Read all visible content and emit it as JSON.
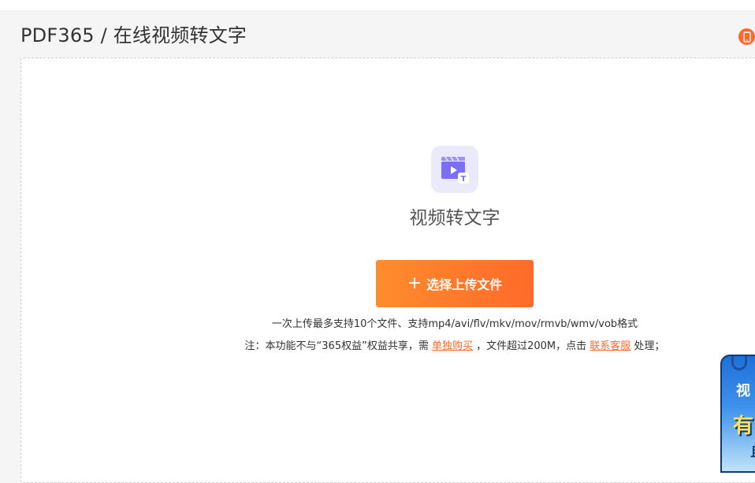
{
  "header": {
    "title": "PDF365 / 在线视频转文字"
  },
  "tool": {
    "name": "视频转文字",
    "upload_label": "选择上传文件",
    "upload_plus": "+"
  },
  "notes": {
    "line1": "一次上传最多支持10个文件、支持mp4/avi/flv/mkv/mov/rmvb/wmv/vob格式",
    "line2_prefix": "注：本功能不与“365权益”权益共享，需 ",
    "purchase_link": "单独购买",
    "line2_middle": " ，文件超过200M，点击 ",
    "contact_link": "联系客服",
    "line2_suffix": " 处理；"
  },
  "promo": {
    "text1": "视",
    "text2": "有",
    "text3": "且"
  },
  "icons": {
    "mobile": "mobile-phone-icon",
    "tool": "video-to-text-icon"
  },
  "colors": {
    "accent": "#ff6a2a",
    "accent_start": "#ff8c2c",
    "icon_bg": "#ebeafd",
    "icon_fg": "#7b6ff2"
  }
}
